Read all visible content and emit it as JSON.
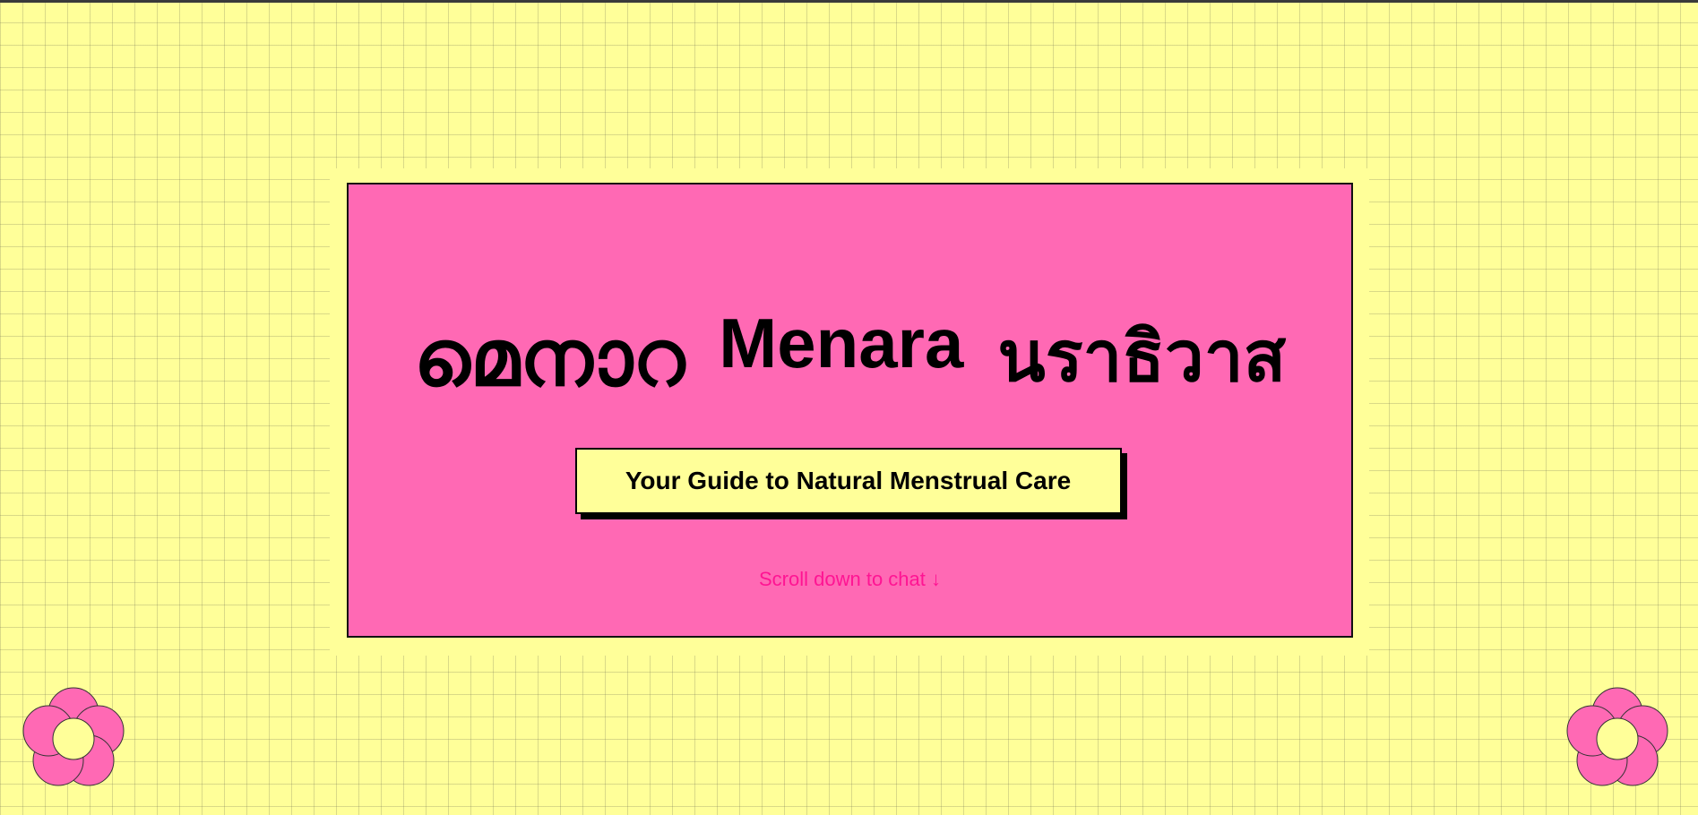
{
  "hero": {
    "title_left": "മെനാറ",
    "title_middle": "Menara",
    "title_right": "นราธิวาส",
    "subtitle": "Your Guide to Natural Menstrual Care",
    "scroll_hint": "Scroll down to chat ↓"
  },
  "decorations": {
    "left_icon": "flower-icon",
    "right_icon": "flower-icon"
  },
  "colors": {
    "background": "#ffff99",
    "hero_background": "#ff69b4",
    "accent_text": "#ff1493",
    "flower_petal": "#ff69b4"
  }
}
